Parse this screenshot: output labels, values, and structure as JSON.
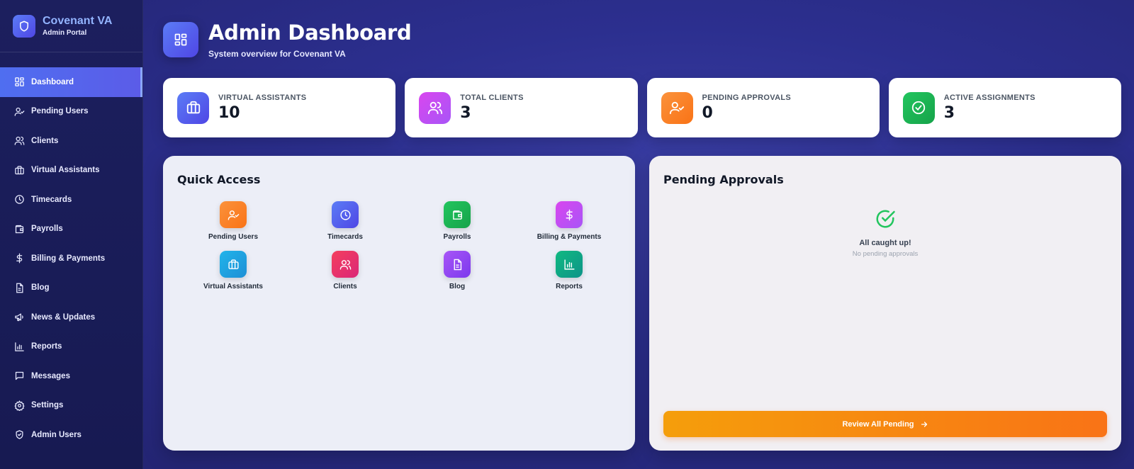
{
  "brand": {
    "title": "Covenant VA",
    "subtitle": "Admin Portal",
    "icon": "shield-icon"
  },
  "sidebar": {
    "items": [
      {
        "label": "Dashboard",
        "icon": "grid-icon",
        "active": true
      },
      {
        "label": "Pending Users",
        "icon": "user-check-icon"
      },
      {
        "label": "Clients",
        "icon": "users-icon"
      },
      {
        "label": "Virtual Assistants",
        "icon": "briefcase-icon"
      },
      {
        "label": "Timecards",
        "icon": "clock-icon"
      },
      {
        "label": "Payrolls",
        "icon": "wallet-icon"
      },
      {
        "label": "Billing & Payments",
        "icon": "dollar-icon"
      },
      {
        "label": "Blog",
        "icon": "document-icon"
      },
      {
        "label": "News & Updates",
        "icon": "megaphone-icon"
      },
      {
        "label": "Reports",
        "icon": "bar-chart-icon"
      },
      {
        "label": "Messages",
        "icon": "message-icon"
      },
      {
        "label": "Settings",
        "icon": "gear-icon"
      },
      {
        "label": "Admin Users",
        "icon": "shield-check-icon"
      }
    ]
  },
  "header": {
    "title": "Admin Dashboard",
    "subtitle": "System overview for Covenant VA",
    "icon": "grid-icon"
  },
  "stats": [
    {
      "label": "Virtual Assistants",
      "value": "10",
      "icon": "briefcase-icon",
      "color": "#4f6ef0"
    },
    {
      "label": "Total Clients",
      "value": "3",
      "icon": "users-icon",
      "color": "#c946d6"
    },
    {
      "label": "Pending Approvals",
      "value": "0",
      "icon": "user-check-icon",
      "color": "#f97316"
    },
    {
      "label": "Active Assignments",
      "value": "3",
      "icon": "check-circle-icon",
      "color": "#16a34a"
    }
  ],
  "quick_access": {
    "title": "Quick Access",
    "items": [
      {
        "label": "Pending Users",
        "icon": "user-check-icon",
        "color": "#f97316"
      },
      {
        "label": "Timecards",
        "icon": "clock-icon",
        "color": "#4f6ef0"
      },
      {
        "label": "Payrolls",
        "icon": "wallet-icon",
        "color": "#16a34a"
      },
      {
        "label": "Billing & Payments",
        "icon": "dollar-icon",
        "color": "#c946d6"
      },
      {
        "label": "Virtual Assistants",
        "icon": "briefcase-icon",
        "color": "#1da1e0"
      },
      {
        "label": "Clients",
        "icon": "users-icon",
        "color": "#e3376b"
      },
      {
        "label": "Blog",
        "icon": "document-icon",
        "color": "#8b47e6"
      },
      {
        "label": "Reports",
        "icon": "bar-chart-icon",
        "color": "#0f9f7a"
      }
    ]
  },
  "pending_approvals": {
    "title": "Pending Approvals",
    "empty_title": "All caught up!",
    "empty_subtitle": "No pending approvals",
    "button_label": "Review All Pending"
  }
}
